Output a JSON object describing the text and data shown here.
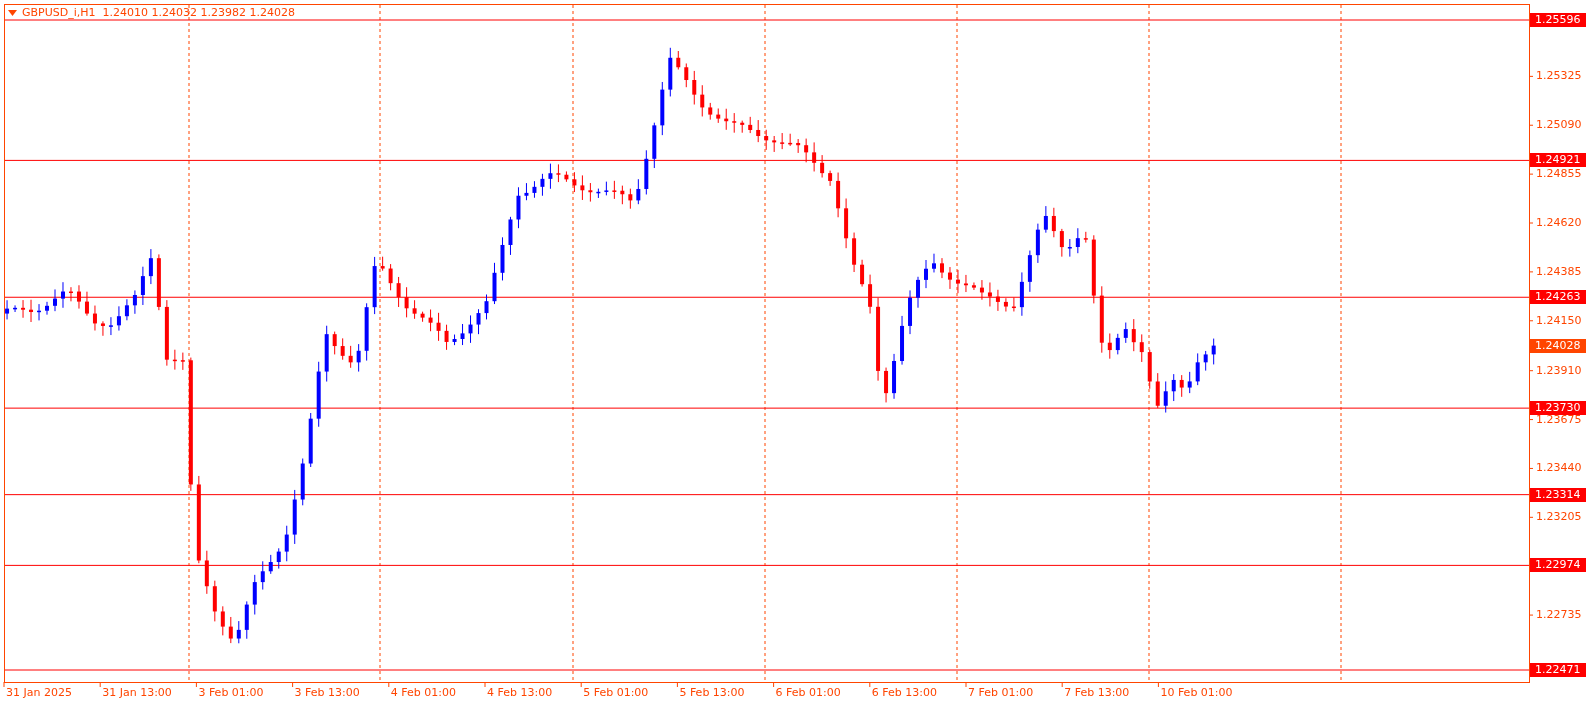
{
  "chart_title": "GBPUSD_i,H1  1.24010 1.24032 1.23982 1.24028",
  "price_axis": [
    "1.25325",
    "1.25090",
    "1.24855",
    "1.24620",
    "1.24385",
    "1.24150",
    "1.23910",
    "1.23675",
    "1.23440",
    "1.23205",
    "1.22735"
  ],
  "price_labels": [
    {
      "kind": "level",
      "value": "1.25596"
    },
    {
      "kind": "level",
      "value": "1.24921"
    },
    {
      "kind": "level",
      "value": "1.24263"
    },
    {
      "kind": "current",
      "value": "1.24028"
    },
    {
      "kind": "level",
      "value": "1.23730"
    },
    {
      "kind": "level",
      "value": "1.23314"
    },
    {
      "kind": "level",
      "value": "1.22974"
    },
    {
      "kind": "level",
      "value": "1.22471"
    }
  ],
  "time_axis": [
    "31 Jan 2025",
    "31 Jan 13:00",
    "3 Feb 01:00",
    "3 Feb 13:00",
    "4 Feb 01:00",
    "4 Feb 13:00",
    "5 Feb 01:00",
    "5 Feb 13:00",
    "6 Feb 01:00",
    "6 Feb 13:00",
    "7 Feb 01:00",
    "7 Feb 13:00",
    "10 Feb 01:00"
  ]
}
